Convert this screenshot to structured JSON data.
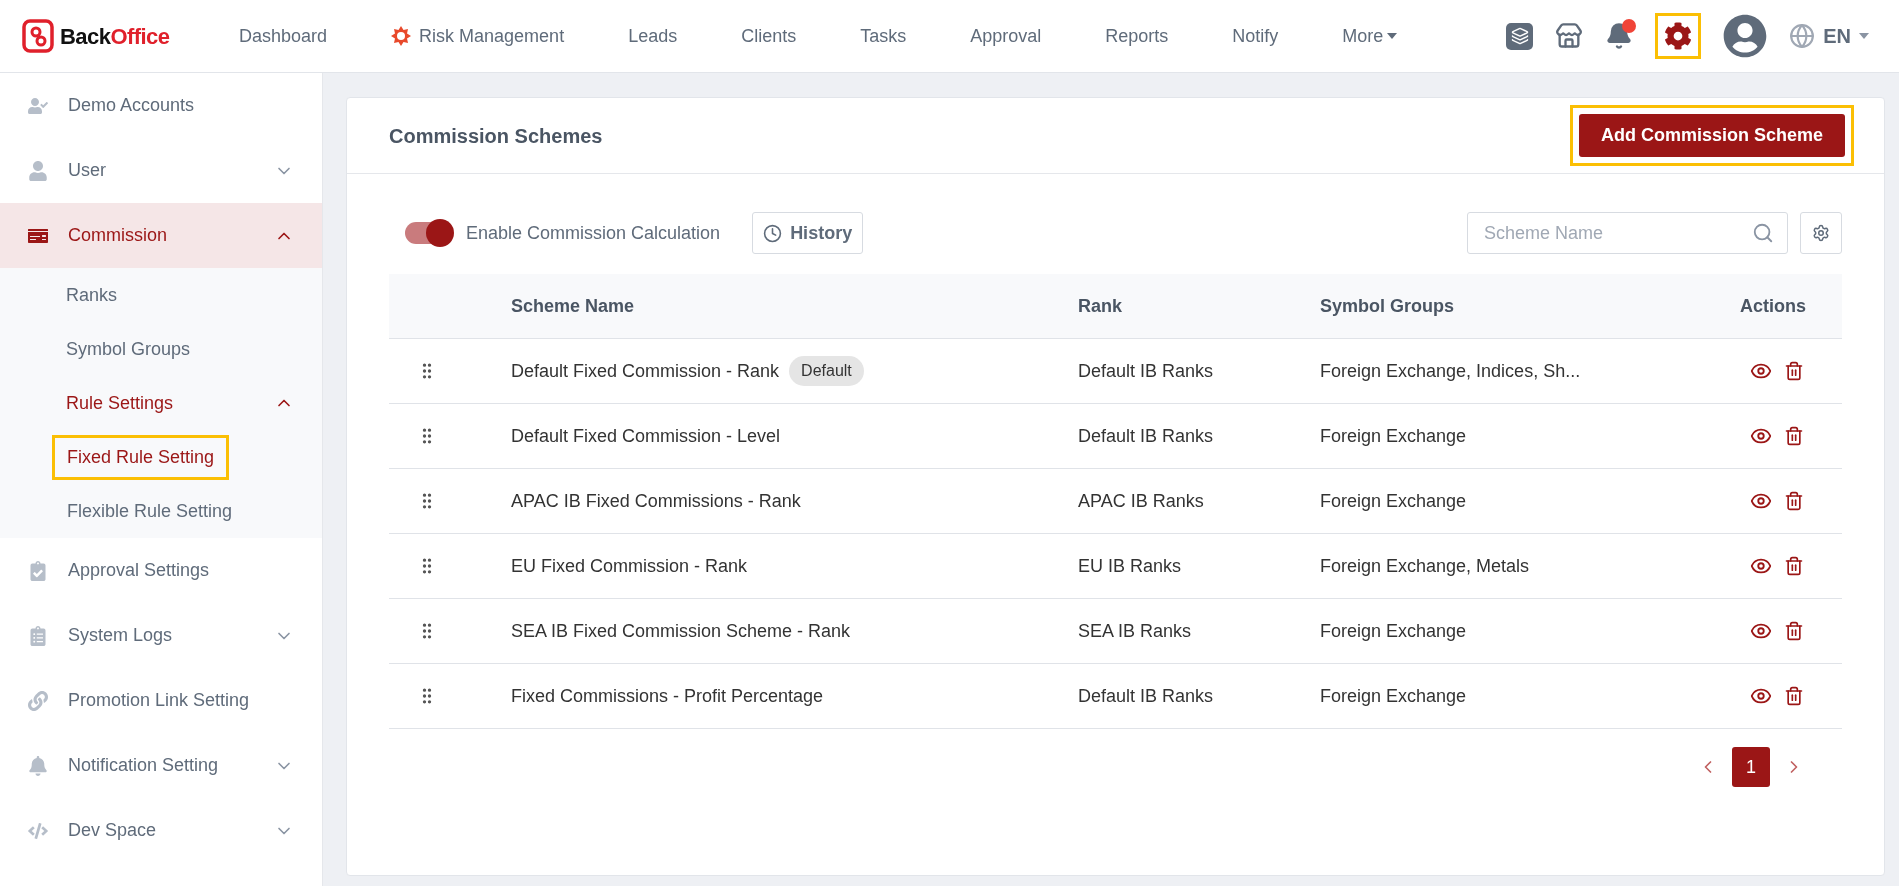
{
  "brand": {
    "prefix": "Back",
    "suffix": "Office"
  },
  "nav": [
    {
      "label": "Dashboard",
      "kind": "plain"
    },
    {
      "label": "Risk Management",
      "kind": "flagged"
    },
    {
      "label": "Leads",
      "kind": "plain"
    },
    {
      "label": "Clients",
      "kind": "plain"
    },
    {
      "label": "Tasks",
      "kind": "plain"
    },
    {
      "label": "Approval",
      "kind": "plain"
    },
    {
      "label": "Reports",
      "kind": "plain"
    },
    {
      "label": "Notify",
      "kind": "plain"
    },
    {
      "label": "More",
      "kind": "dropdown"
    }
  ],
  "toolbar": {
    "notifications_unread": true,
    "settings_highlighted": true,
    "language": "EN"
  },
  "sidebar": {
    "items": [
      {
        "label": "Demo Accounts",
        "selected": false
      },
      {
        "label": "User",
        "selected": false,
        "expanded": false
      },
      {
        "label": "Commission",
        "selected": true,
        "expanded": true,
        "children": [
          {
            "label": "Ranks",
            "selected": false
          },
          {
            "label": "Symbol Groups",
            "selected": false
          },
          {
            "label": "Rule Settings",
            "selected": true,
            "expanded": true,
            "children": [
              {
                "label": "Fixed Rule Setting",
                "selected": true,
                "highlighted": true
              },
              {
                "label": "Flexible Rule Setting",
                "selected": false,
                "highlighted": false
              }
            ]
          }
        ]
      },
      {
        "label": "Approval Settings",
        "selected": false
      },
      {
        "label": "System Logs",
        "selected": false,
        "expanded": false
      },
      {
        "label": "Promotion Link Setting",
        "selected": false
      },
      {
        "label": "Notification Setting",
        "selected": false,
        "expanded": false
      },
      {
        "label": "Dev Space",
        "selected": false,
        "expanded": false
      }
    ]
  },
  "card": {
    "title": "Commission Schemes",
    "add_button": {
      "label": "Add Commission Scheme",
      "highlighted": true
    },
    "toggle": {
      "label": "Enable Commission Calculation",
      "on": true
    },
    "history_button": "History",
    "search": {
      "placeholder": "Scheme Name"
    },
    "table": {
      "columns": [
        "Scheme Name",
        "Rank",
        "Symbol Groups",
        "Actions"
      ],
      "rows": [
        {
          "name": "Default Fixed Commission - Rank",
          "badge": "Default",
          "rank": "Default IB Ranks",
          "symbol_groups": "Foreign Exchange, Indices, Sh..."
        },
        {
          "name": "Default Fixed Commission - Level",
          "rank": "Default IB Ranks",
          "symbol_groups": "Foreign Exchange"
        },
        {
          "name": "APAC IB Fixed Commissions - Rank",
          "rank": "APAC IB Ranks",
          "symbol_groups": "Foreign Exchange"
        },
        {
          "name": "EU Fixed Commission - Rank",
          "rank": "EU IB Ranks",
          "symbol_groups": "Foreign Exchange, Metals"
        },
        {
          "name": "SEA IB Fixed Commission Scheme - Rank",
          "rank": "SEA IB Ranks",
          "symbol_groups": "Foreign Exchange"
        },
        {
          "name": "Fixed Commissions - Profit Percentage",
          "rank": "Default IB Ranks",
          "symbol_groups": "Foreign Exchange"
        }
      ]
    },
    "pagination": {
      "pages": [
        {
          "label": "1",
          "selected": true
        }
      ]
    }
  }
}
